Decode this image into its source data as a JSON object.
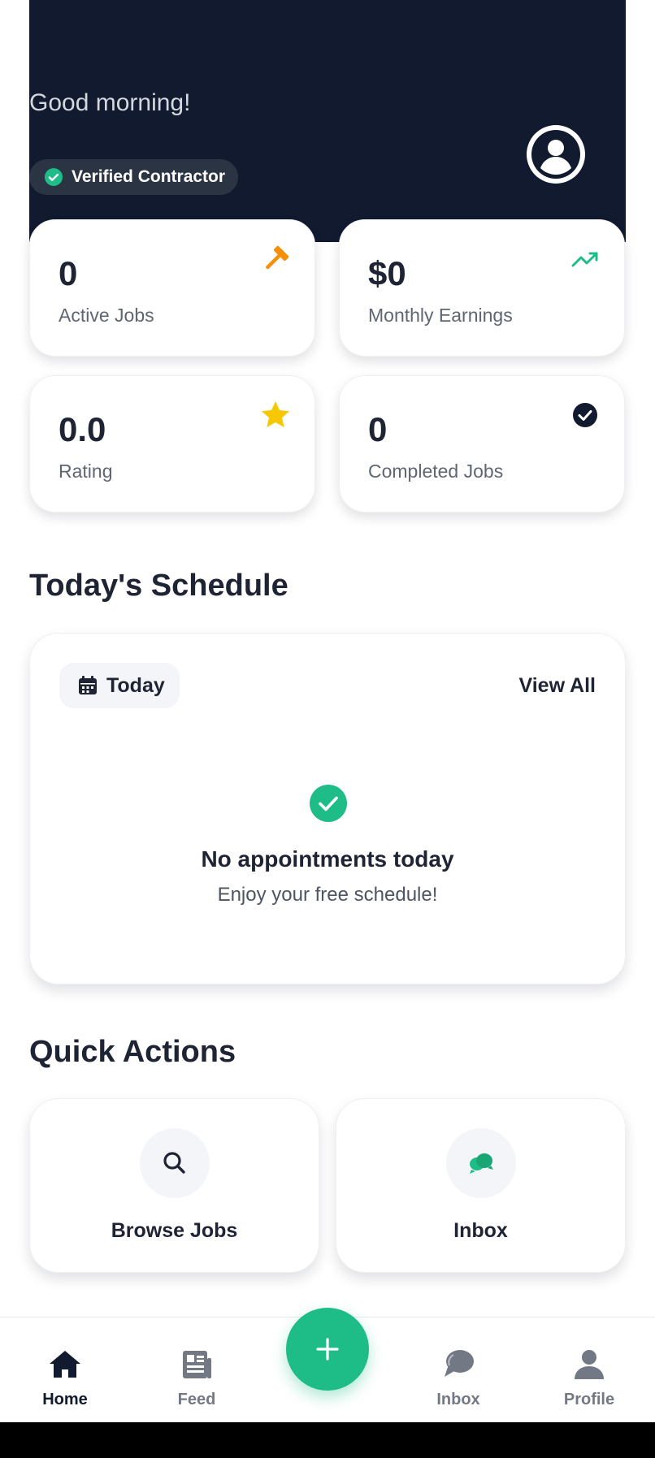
{
  "header": {
    "greeting": "Good morning!",
    "verified_badge": "Verified Contractor",
    "avatar_icon": "user-circle-icon"
  },
  "stats": [
    {
      "value": "0",
      "label": "Active Jobs",
      "icon": "hammer-icon",
      "color": "#f5900a"
    },
    {
      "value": "$0",
      "label": "Monthly Earnings",
      "icon": "trending-up-icon",
      "color": "#1ebd87"
    },
    {
      "value": "0.0",
      "label": "Rating",
      "icon": "star-icon",
      "color": "#f7c800"
    },
    {
      "value": "0",
      "label": "Completed Jobs",
      "icon": "check-circle-icon",
      "color": "#111a2e"
    }
  ],
  "schedule": {
    "title": "Today's Schedule",
    "chip_label": "Today",
    "view_all": "View All",
    "empty_title": "No appointments today",
    "empty_subtitle": "Enjoy your free schedule!"
  },
  "quick_actions": {
    "title": "Quick Actions",
    "items": [
      {
        "label": "Browse Jobs",
        "icon": "search-icon"
      },
      {
        "label": "Inbox",
        "icon": "chat-bubbles-icon"
      }
    ]
  },
  "bottom_nav": {
    "items": [
      {
        "label": "Home",
        "icon": "home-icon",
        "active": true
      },
      {
        "label": "Feed",
        "icon": "newspaper-icon",
        "active": false
      },
      {
        "label": "Inbox",
        "icon": "chat-icon",
        "active": false
      },
      {
        "label": "Profile",
        "icon": "user-icon",
        "active": false
      }
    ],
    "fab_icon": "plus-icon"
  },
  "colors": {
    "hero_bg": "#111a2e",
    "accent_green": "#1ebd87",
    "text_dark": "#1e2433",
    "text_muted": "#5f6673"
  }
}
